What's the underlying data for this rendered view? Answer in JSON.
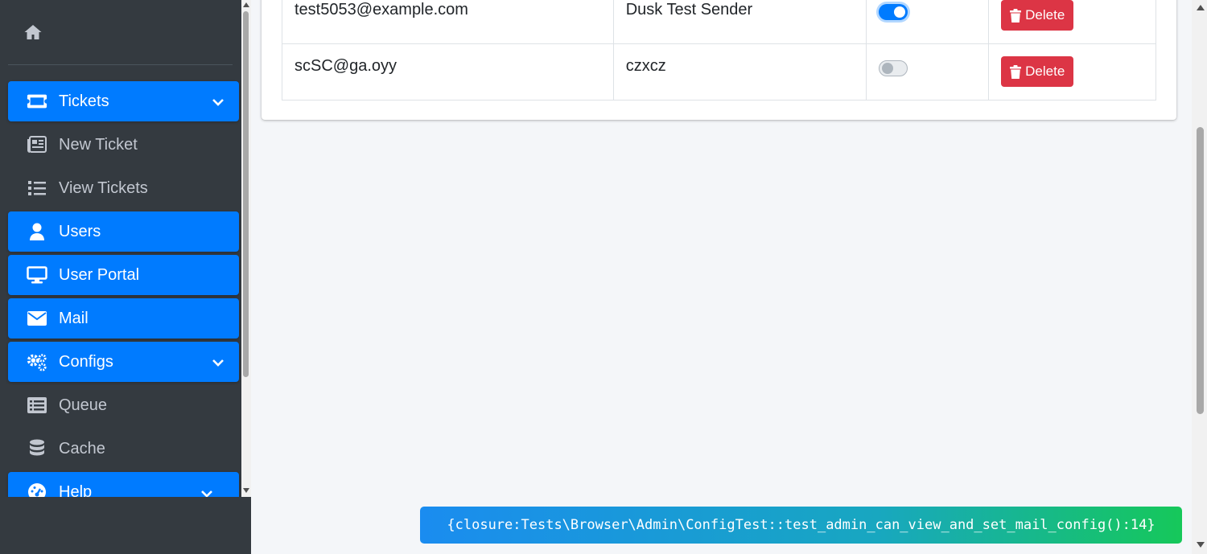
{
  "sidebar": {
    "home_icon": "home-icon",
    "items": [
      {
        "label": "Tickets",
        "icon": "ticket-icon",
        "active": true,
        "expandable": true
      },
      {
        "label": "New Ticket",
        "icon": "newspaper-icon",
        "active": false
      },
      {
        "label": "View Tickets",
        "icon": "list-icon",
        "active": false
      },
      {
        "label": "Users",
        "icon": "user-icon",
        "active": true
      },
      {
        "label": "User Portal",
        "icon": "desktop-icon",
        "active": true
      },
      {
        "label": "Mail",
        "icon": "envelope-icon",
        "active": true
      },
      {
        "label": "Configs",
        "icon": "cogs-icon",
        "active": true,
        "expandable": true
      },
      {
        "label": "Queue",
        "icon": "list-alt-icon",
        "active": false
      },
      {
        "label": "Cache",
        "icon": "database-icon",
        "active": false
      },
      {
        "label": "Help",
        "icon": "tachometer-icon",
        "active": true,
        "expandable": true
      }
    ]
  },
  "mail_table": {
    "rows": [
      {
        "email": "test5053@example.com",
        "name": "Dusk Test Sender",
        "enabled": true,
        "delete_label": "Delete"
      },
      {
        "email": "scSC@ga.oyy",
        "name": "czxcz",
        "enabled": false,
        "delete_label": "Delete"
      }
    ]
  },
  "toast": {
    "text": "{closure:Tests\\Browser\\Admin\\ConfigTest::test_admin_can_view_and_set_mail_config():14}"
  },
  "colors": {
    "sidebar_bg": "#343a40",
    "active_blue": "#007bff",
    "danger": "#dc3545",
    "content_bg": "#f4f6f9"
  }
}
